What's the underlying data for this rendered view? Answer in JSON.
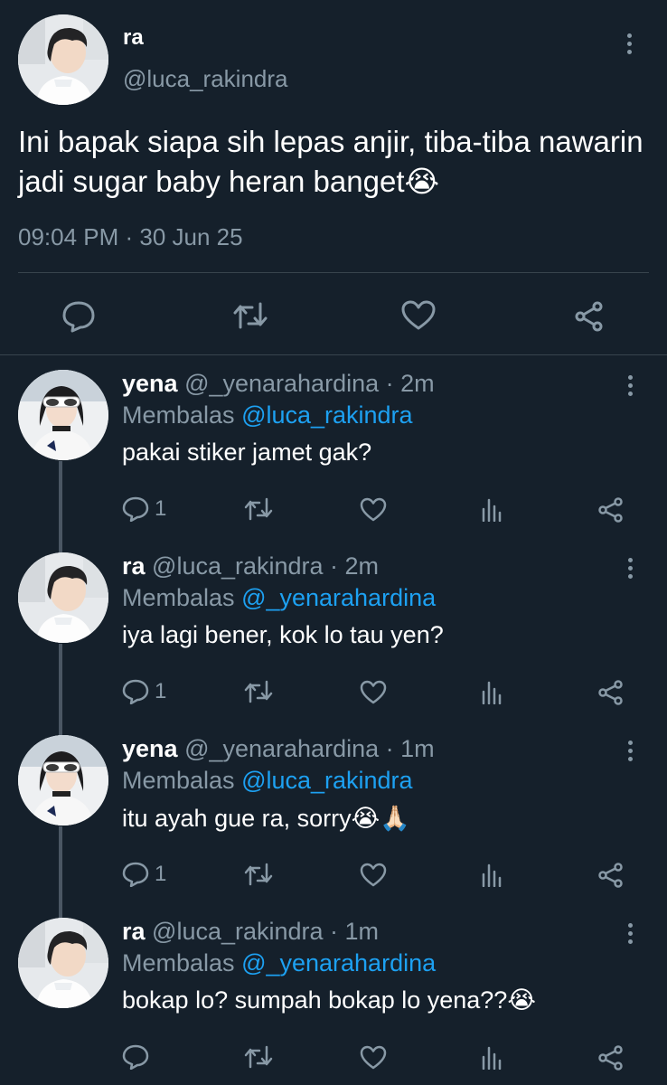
{
  "main_tweet": {
    "name": "ra",
    "handle": "@luca_rakindra",
    "text": "Ini bapak siapa sih lepas anjir,  tiba-tiba nawarin jadi sugar baby heran banget",
    "emoji": "😭",
    "timestamp": "09:04 PM · 30 Jun 25"
  },
  "replies": [
    {
      "name": "yena",
      "meta": "@_yenarahardina · 2m",
      "reply_prefix": "Membalas",
      "mention": "@luca_rakindra",
      "text": "pakai stiker jamet gak?",
      "emoji": "",
      "reply_count": "1"
    },
    {
      "name": "ra",
      "meta": "@luca_rakindra · 2m",
      "reply_prefix": "Membalas",
      "mention": "@_yenarahardina",
      "text": "iya lagi bener, kok lo tau yen?",
      "emoji": "",
      "reply_count": "1"
    },
    {
      "name": "yena",
      "meta": "@_yenarahardina · 1m",
      "reply_prefix": "Membalas",
      "mention": "@luca_rakindra",
      "text": "itu ayah gue ra, sorry",
      "emoji": "😭🙏🏻",
      "reply_count": "1"
    },
    {
      "name": "ra",
      "meta": "@luca_rakindra · 1m",
      "reply_prefix": "Membalas",
      "mention": "@_yenarahardina",
      "text": "bokap lo? sumpah bokap lo yena??",
      "emoji": "😭",
      "reply_count": ""
    }
  ],
  "icons": {
    "reply": "reply-icon",
    "retweet": "retweet-icon",
    "like": "heart-icon",
    "analytics": "analytics-icon",
    "share": "share-icon",
    "more": "more-vertical-icon"
  },
  "colors": {
    "background": "#15202b",
    "secondary_text": "#8899a6",
    "mention": "#1da1f2",
    "divider": "#38444d"
  }
}
